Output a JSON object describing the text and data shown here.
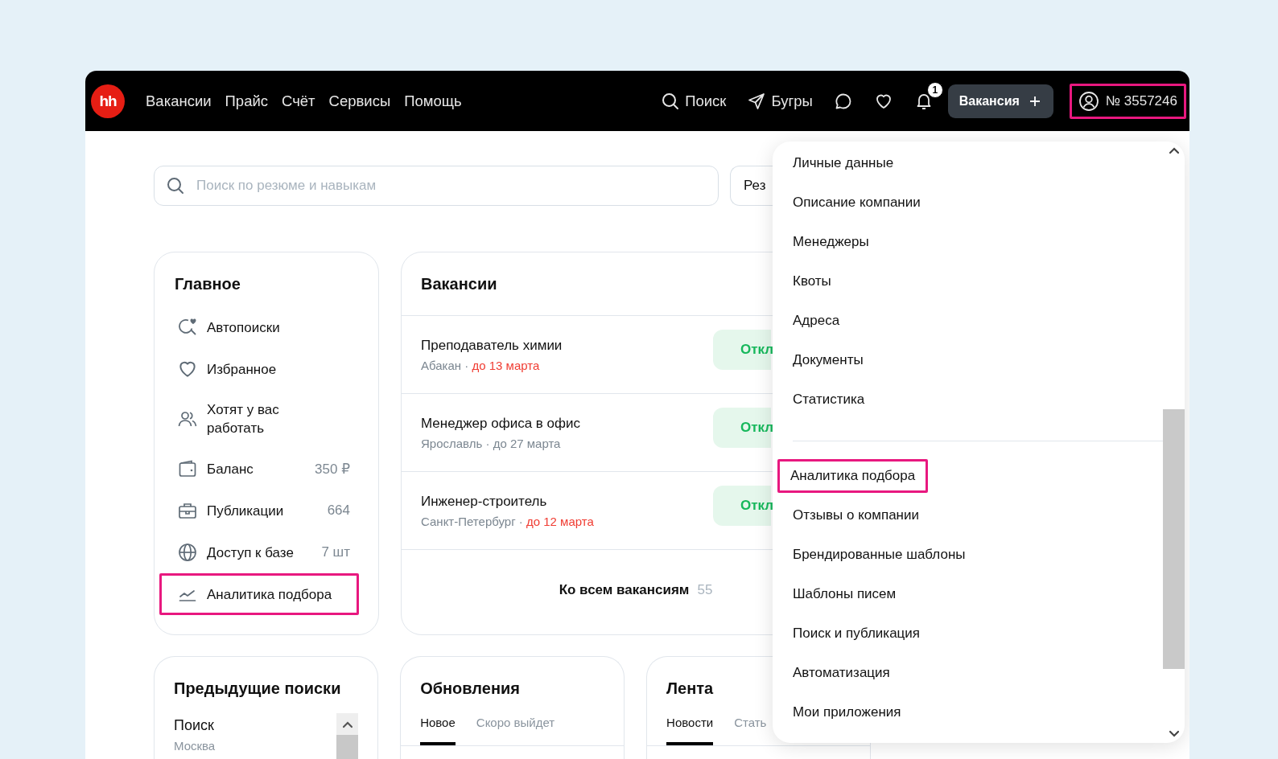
{
  "header": {
    "logo": "hh",
    "nav": [
      "Вакансии",
      "Прайс",
      "Счёт",
      "Сервисы",
      "Помощь"
    ],
    "search": "Поиск",
    "region": "Бугры",
    "notification_count": "1",
    "vacancy_button": "Вакансия",
    "account": {
      "label": "№ 3557246",
      "highlighted": true
    }
  },
  "resume_search": {
    "placeholder": "Поиск по резюме и навыкам",
    "button": "Рез"
  },
  "main_menu": {
    "title": "Главное",
    "items": [
      {
        "label": "Автопоиски",
        "highlighted": false
      },
      {
        "label": "Избранное",
        "highlighted": false
      },
      {
        "label": "Хотят у вас работать",
        "highlighted": false
      },
      {
        "label": "Баланс",
        "value": "350 ₽",
        "highlighted": false
      },
      {
        "label": "Публикации",
        "value": "664",
        "highlighted": false
      },
      {
        "label": "Доступ к базе",
        "value": "7 шт",
        "highlighted": false
      },
      {
        "label": "Аналитика подбора",
        "highlighted": true
      }
    ]
  },
  "vacancies": {
    "title": "Вакансии",
    "items": [
      {
        "title": "Преподаватель химии",
        "city": "Абакан",
        "separator": "·",
        "deadline": "до 13 марта",
        "deadline_urgent": true,
        "action": "Откл"
      },
      {
        "title": "Менеджер офиса в офис",
        "city": "Ярославль",
        "separator": "·",
        "deadline": "до 27 марта",
        "deadline_urgent": false,
        "action": "Откл"
      },
      {
        "title": "Инженер-строитель",
        "city": "Санкт-Петербург",
        "separator": "·",
        "deadline": "до 12 марта",
        "deadline_urgent": true,
        "action": "Откл"
      }
    ],
    "footer": "Ко всем вакансиям",
    "count": "55"
  },
  "previous_searches": {
    "title": "Предыдущие поиски",
    "items": [
      {
        "query": "Поиск",
        "place": "Москва"
      }
    ]
  },
  "updates": {
    "title": "Обновления",
    "tabs": [
      {
        "label": "Новое",
        "selected": true
      },
      {
        "label": "Скоро выйдет",
        "selected": false
      }
    ]
  },
  "feed": {
    "title": "Лента",
    "tabs": [
      {
        "label": "Новости",
        "selected": true
      },
      {
        "label": "Стать",
        "selected": false
      }
    ]
  },
  "account_menu": {
    "groups": [
      {
        "items": [
          {
            "label": "Личные данные",
            "highlighted": false
          },
          {
            "label": "Описание компании",
            "highlighted": false
          },
          {
            "label": "Менеджеры",
            "highlighted": false
          },
          {
            "label": "Квоты",
            "highlighted": false
          },
          {
            "label": "Адреса",
            "highlighted": false
          },
          {
            "label": "Документы",
            "highlighted": false
          },
          {
            "label": "Статистика",
            "highlighted": false
          }
        ]
      },
      {
        "items": [
          {
            "label": "Аналитика подбора",
            "highlighted": true
          },
          {
            "label": "Отзывы о компании",
            "highlighted": false
          },
          {
            "label": "Брендированные шаблоны",
            "highlighted": false
          },
          {
            "label": "Шаблоны писем",
            "highlighted": false
          },
          {
            "label": "Поиск и публикация",
            "highlighted": false
          },
          {
            "label": "Автоматизация",
            "highlighted": false
          },
          {
            "label": "Мои приложения",
            "highlighted": false
          }
        ]
      }
    ]
  }
}
